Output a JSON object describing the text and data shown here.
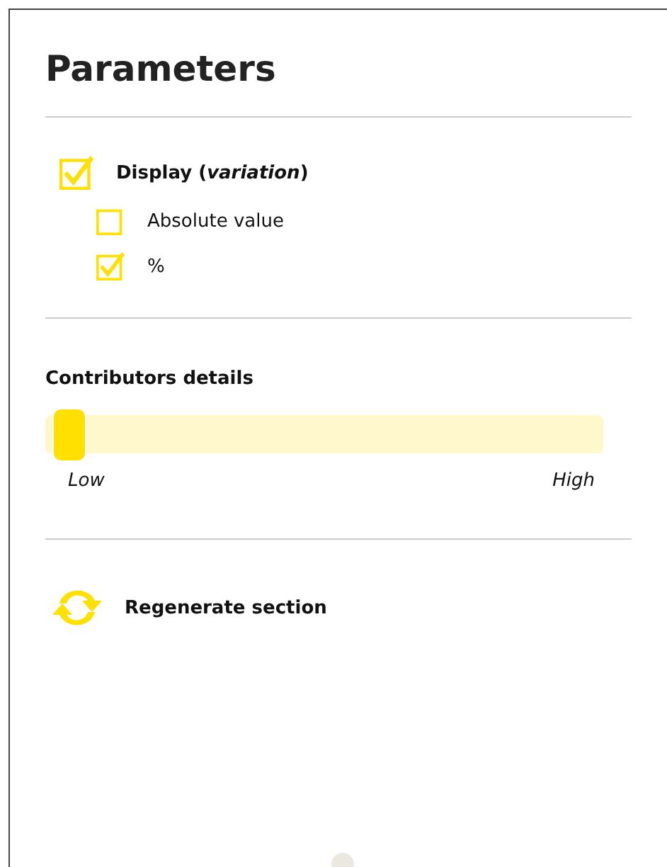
{
  "title": "Parameters",
  "display": {
    "label": "Display (*variation*)",
    "checked": true,
    "options": [
      {
        "label": "Absolute value",
        "checked": false
      },
      {
        "label": "%",
        "checked": true
      }
    ]
  },
  "contributors": {
    "title": "Contributors details",
    "level": 0,
    "low_label": "Low",
    "high_label": "High"
  },
  "regenerate": {
    "label": "Regenerate section"
  }
}
